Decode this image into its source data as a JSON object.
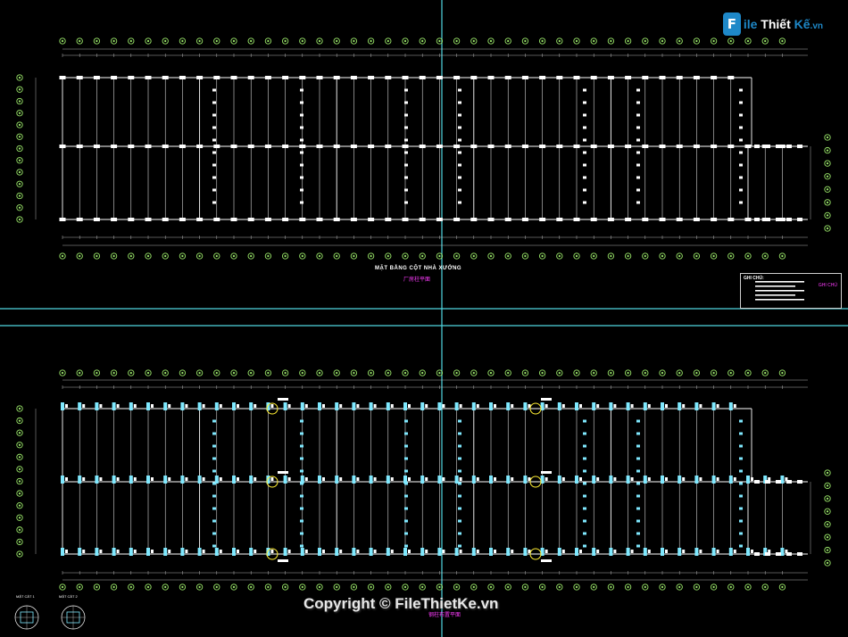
{
  "logo": {
    "badge": "F",
    "name_a": "ile",
    "name_b": "Thiết",
    "name_c": "Kế",
    "name_d": ".vn"
  },
  "plan_top": {
    "title": "MẶT BẰNG CỘT NHÀ XƯỞNG",
    "subtitle": "厂房柱平面"
  },
  "plan_bottom": {
    "subtitle": "钢柱布置平面"
  },
  "notes": {
    "heading": "GHI CHÚ:",
    "mark": "GHI CHÚ"
  },
  "legend": {
    "label_a": "MẶT CẮT 1",
    "label_b": "MẶT CẮT 2"
  },
  "watermark": {
    "copyright": "Copyright © FileThietKe.vn"
  },
  "colors": {
    "background": "#000000",
    "grid_line": "#ffffff",
    "axis_bubble": "#9be86a",
    "frame": "#4fd6e0",
    "tag": "#7fe9ff",
    "dimension": "#d9d9d9",
    "accent": "#ff3cff",
    "highlight_bubble": "#ffee33"
  }
}
